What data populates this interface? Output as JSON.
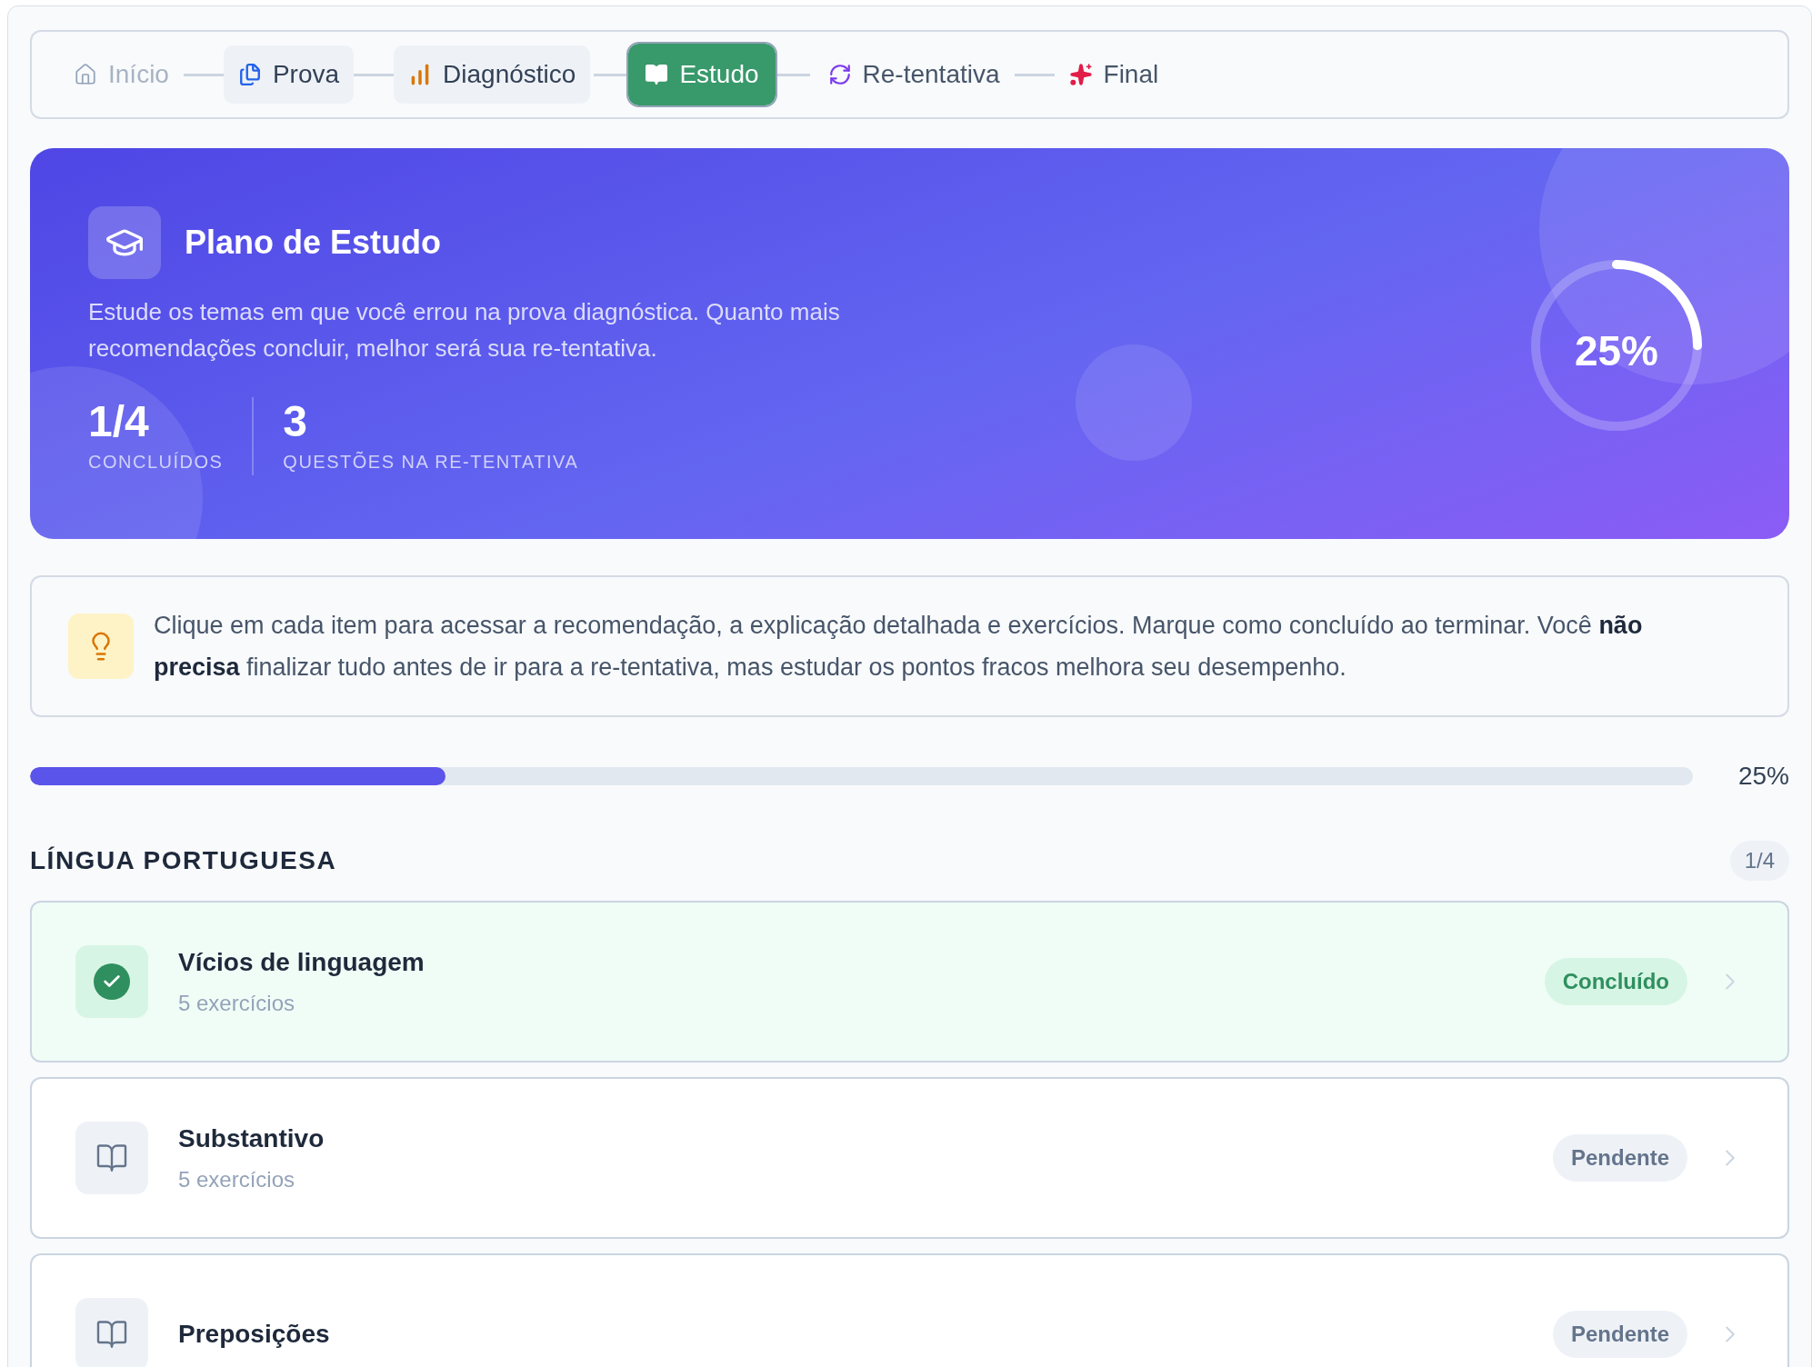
{
  "stepper": [
    {
      "label": "Início",
      "kind": "home",
      "disabled": true,
      "done": false,
      "selected": false
    },
    {
      "label": "Prova",
      "kind": "exam",
      "disabled": false,
      "done": true,
      "selected": false
    },
    {
      "label": "Diagnóstico",
      "kind": "diagnosis",
      "disabled": false,
      "done": true,
      "selected": false
    },
    {
      "label": "Estudo",
      "kind": "study",
      "disabled": false,
      "done": false,
      "selected": true
    },
    {
      "label": "Re-tentativa",
      "kind": "retry",
      "disabled": false,
      "done": false,
      "selected": false
    },
    {
      "label": "Final",
      "kind": "final",
      "disabled": false,
      "done": false,
      "selected": false
    }
  ],
  "hero": {
    "title": "Plano de Estudo",
    "description": "Estude os temas em que você errou na prova diagnóstica. Quanto mais recomendações concluir, melhor será sua re-tentativa.",
    "stats": [
      {
        "value": "1/4",
        "label": "CONCLUÍDOS"
      },
      {
        "value": "3",
        "label": "QUESTÕES NA RE-TENTATIVA"
      }
    ],
    "progress": {
      "level": 0.25,
      "reading": "25%"
    }
  },
  "tip": {
    "text": "Clique em cada item para acessar a recomendação, a explicação detalhada e exercícios. Marque como concluído ao terminar. Você **não precisa** finalizar tudo antes de ir para a re-tentativa, mas estudar os pontos fracos melhora seu desempenho."
  },
  "overall_progress": {
    "level": 0.25,
    "reading": "25%"
  },
  "section": {
    "title": "LÍNGUA PORTUGUESA",
    "count": "1/4",
    "items": [
      {
        "title": "Vícios de linguagem",
        "subtitle": "5 exercícios",
        "status": "Concluído",
        "completed": true
      },
      {
        "title": "Substantivo",
        "subtitle": "5 exercícios",
        "status": "Pendente",
        "completed": false
      },
      {
        "title": "Preposições",
        "status": "Pendente",
        "completed": false
      }
    ]
  }
}
